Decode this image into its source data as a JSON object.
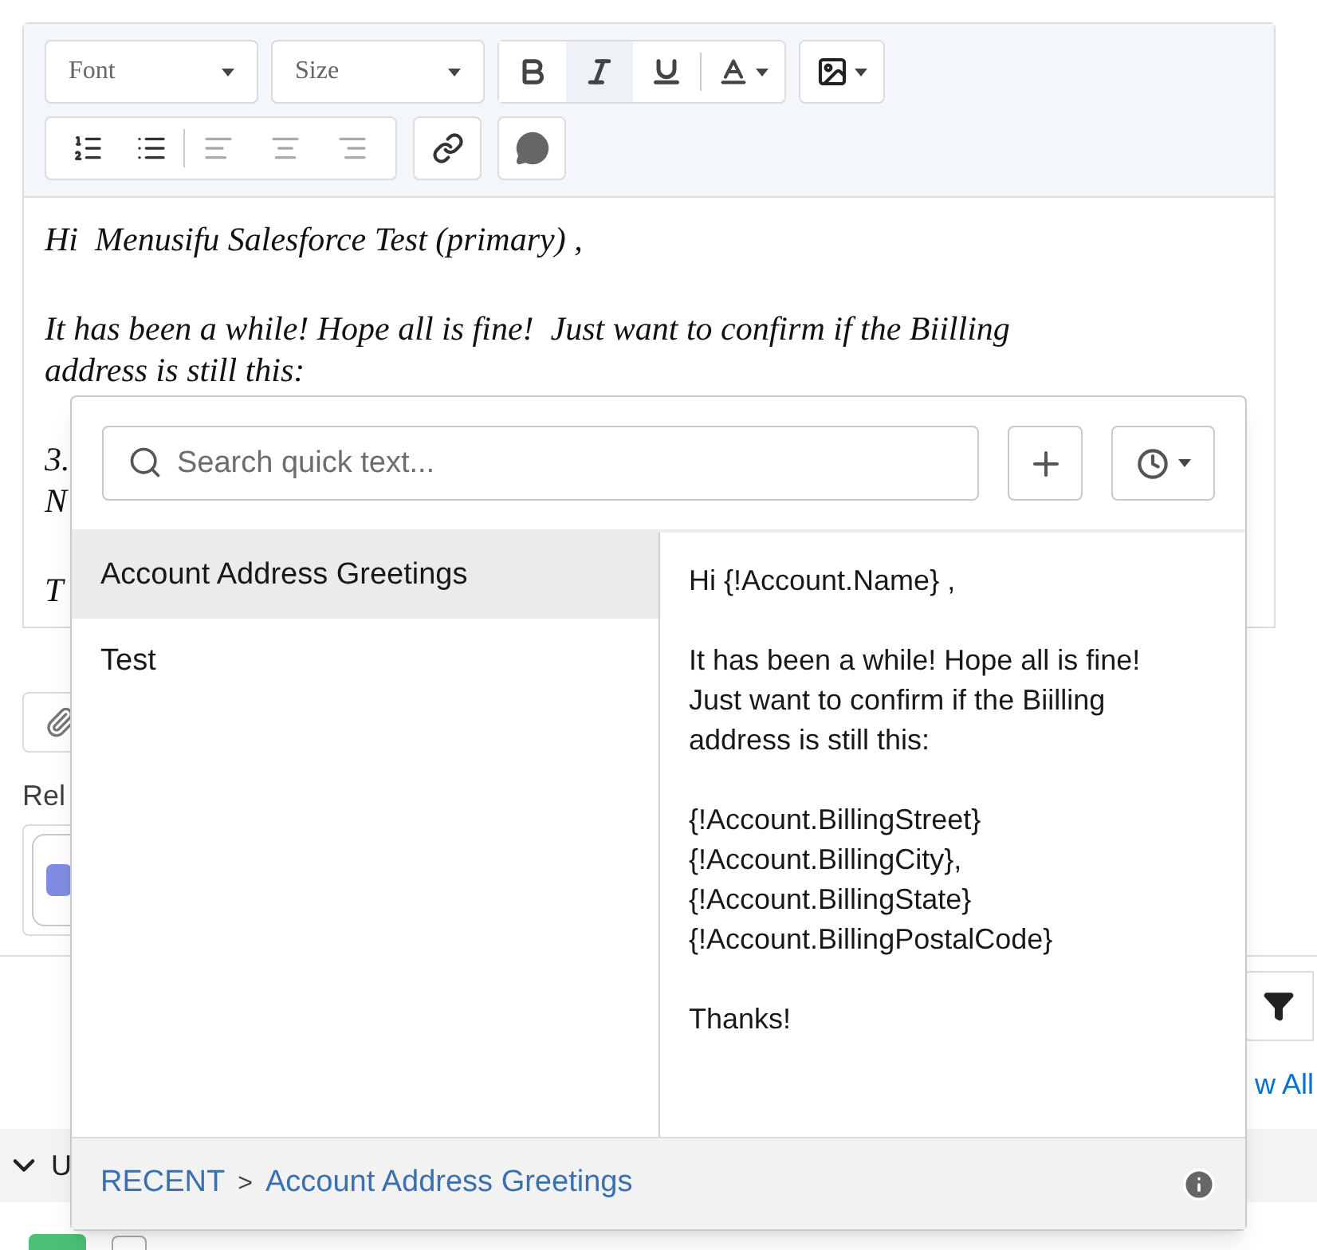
{
  "toolbar": {
    "font_select": "Font",
    "size_select": "Size",
    "formats": [
      {
        "kind": "bold",
        "selected": false
      },
      {
        "kind": "italic",
        "selected": true
      },
      {
        "kind": "underline",
        "selected": false
      }
    ]
  },
  "editor_paragraphs": [
    {
      "lines": [
        "Hi  Menusifu Salesforce Test (primary) ,"
      ]
    },
    {
      "lines": [
        "It has been a while! Hope all is fine!  Just want to confirm if the Biilling",
        "address is still this:"
      ]
    },
    {
      "lines": [
        "3.",
        "N"
      ]
    },
    {
      "lines": [
        "T"
      ]
    }
  ],
  "related_label": "Rel",
  "task_checkbox": {
    "checked": false
  },
  "view_all_link": "w All",
  "section_label": "U",
  "quick_text": {
    "search_placeholder": "Search quick text...",
    "items": [
      {
        "label": "Account Address Greetings",
        "selected": true
      },
      {
        "label": "Test",
        "selected": false
      }
    ],
    "preview_paragraphs": [
      {
        "lines": [
          "Hi {!Account.Name} ,"
        ]
      },
      {
        "lines": [
          "It has been a while! Hope all is fine!",
          "Just want to confirm if the Biilling",
          "address is still this:"
        ]
      },
      {
        "lines": [
          "{!Account.BillingStreet}",
          "{!Account.BillingCity},",
          "{!Account.BillingState}",
          "{!Account.BillingPostalCode}"
        ]
      },
      {
        "lines": [
          "Thanks!"
        ]
      }
    ],
    "breadcrumb": {
      "root": "RECENT",
      "separator": ">",
      "current": "Account Address Greetings"
    }
  }
}
